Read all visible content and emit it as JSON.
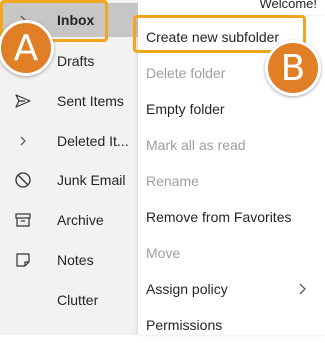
{
  "header": {
    "welcome_text": "Welcome!"
  },
  "folders": [
    {
      "label": "Inbox",
      "icon": "chevron-right-icon"
    },
    {
      "label": "Drafts",
      "icon": "pencil-icon"
    },
    {
      "label": "Sent Items",
      "icon": "send-icon"
    },
    {
      "label": "Deleted It...",
      "icon": "chevron-right-icon"
    },
    {
      "label": "Junk Email",
      "icon": "block-icon"
    },
    {
      "label": "Archive",
      "icon": "archive-icon"
    },
    {
      "label": "Notes",
      "icon": "note-icon"
    },
    {
      "label": "Clutter",
      "icon": ""
    }
  ],
  "context_menu": {
    "items": [
      {
        "label": "Create new subfolder",
        "disabled": false
      },
      {
        "label": "Delete folder",
        "disabled": true
      },
      {
        "label": "Empty folder",
        "disabled": false
      },
      {
        "label": "Mark all as read",
        "disabled": true
      },
      {
        "label": "Rename",
        "disabled": true
      },
      {
        "label": "Remove from Favorites",
        "disabled": false
      },
      {
        "label": "Move",
        "disabled": true
      },
      {
        "label": "Assign policy",
        "disabled": false,
        "has_submenu": true
      },
      {
        "label": "Permissions",
        "disabled": false
      }
    ]
  },
  "callouts": {
    "a_label": "A",
    "b_label": "B"
  },
  "colors": {
    "callout_orange": "#e07f26",
    "highlight_border": "#f2a61d",
    "selected_bg": "#c8c6c4",
    "pane_bg": "#f3f2f1",
    "disabled_text": "#a19f9d"
  }
}
